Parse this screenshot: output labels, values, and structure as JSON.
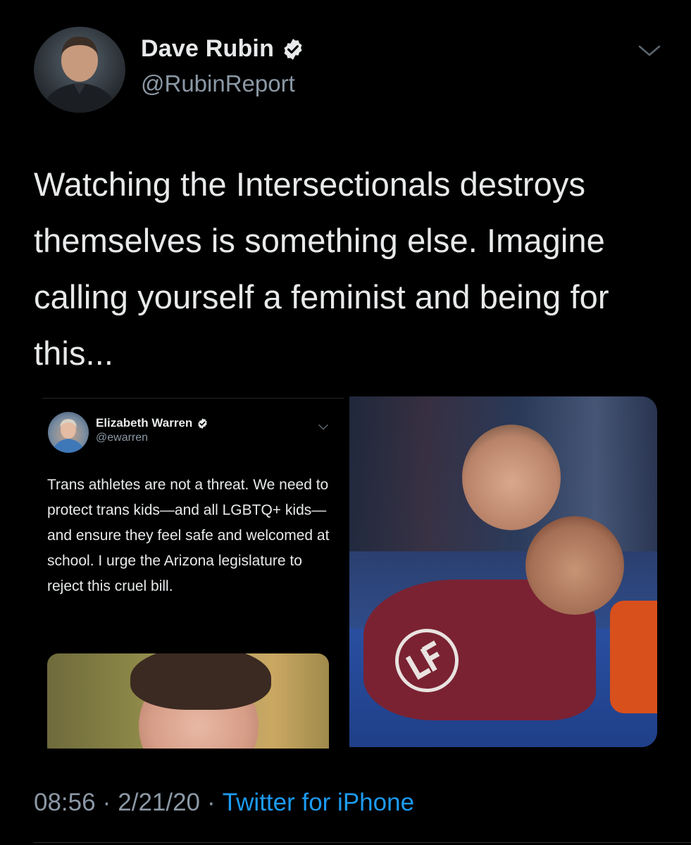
{
  "tweet": {
    "author": {
      "display_name": "Dave Rubin",
      "handle": "@RubinReport",
      "verified": true
    },
    "text": "Watching the Intersectionals destroys themselves is something else. Imagine calling yourself a feminist and being for this...",
    "timestamp": "08:56",
    "date": "2/21/20",
    "source": "Twitter for iPhone",
    "separator": "·"
  },
  "quoted_screenshot": {
    "author": {
      "display_name": "Elizabeth Warren",
      "handle": "@ewarren",
      "verified": true
    },
    "text": "Trans athletes are not a threat. We need to protect trans kids—and all LGBTQ+ kids—and ensure they feel safe and welcomed at school. I urge the Arizona legislature to reject this cruel bill."
  },
  "colors": {
    "background": "#000000",
    "text_primary": "#e7e9ea",
    "text_secondary": "#8b98a5",
    "link": "#1d9bf0",
    "verified_badge": "#e7e9ea"
  },
  "icons": {
    "verified": "verified-badge-icon",
    "more": "chevron-down-icon"
  }
}
